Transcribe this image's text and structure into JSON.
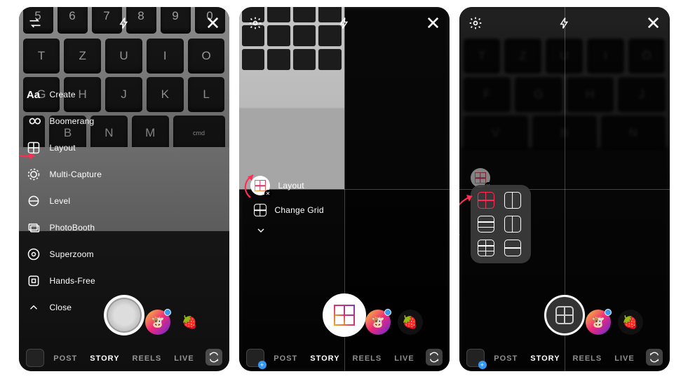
{
  "panel1": {
    "menu": {
      "create": "Create",
      "boomerang": "Boomerang",
      "layout": "Layout",
      "multi": "Multi-Capture",
      "level": "Level",
      "photobooth": "PhotoBooth",
      "superzoom": "Superzoom",
      "handsfree": "Hands-Free",
      "close": "Close"
    },
    "modes": {
      "post": "POST",
      "story": "STORY",
      "reels": "REELS",
      "live": "LIVE"
    },
    "keys_r1": [
      "5",
      "6",
      "7",
      "8",
      "9",
      "0"
    ],
    "keys_r2": [
      "T",
      "Z",
      "U",
      "I",
      "O"
    ],
    "keys_r3": [
      "G",
      "H",
      "J",
      "K",
      "L"
    ],
    "keys_r4": [
      "B",
      "N",
      "M"
    ]
  },
  "panel2": {
    "layout_label": "Layout",
    "change_grid": "Change Grid",
    "modes": {
      "post": "POST",
      "story": "STORY",
      "reels": "REELS",
      "live": "LIVE"
    }
  },
  "panel3": {
    "modes": {
      "post": "POST",
      "story": "STORY",
      "reels": "REELS",
      "live": "LIVE"
    },
    "keys_r2": [
      "T",
      "Z",
      "U",
      "I",
      "Ö"
    ],
    "keys_r3": [
      "F",
      "G",
      "H",
      "J"
    ],
    "keys_r4": [
      "V",
      "B",
      "N"
    ]
  }
}
